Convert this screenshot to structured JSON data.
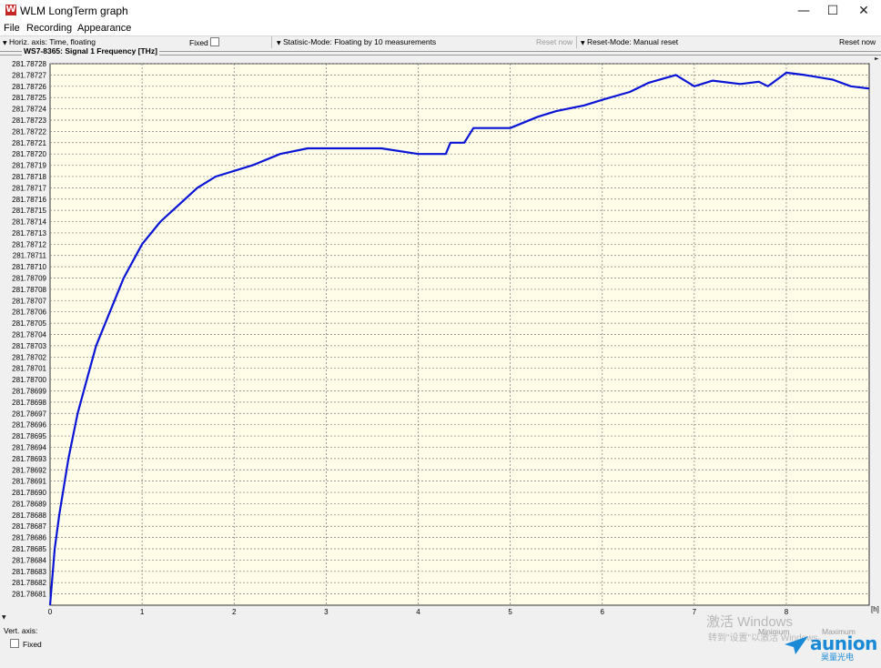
{
  "window": {
    "title": "WLM LongTerm graph",
    "icon": "wlm-app-icon",
    "min_glyph": "—",
    "max_glyph": "☐",
    "close_glyph": "✕"
  },
  "menu": [
    "File",
    "Recording",
    "Appearance"
  ],
  "toolbar": {
    "horiz_axis": "Horiz. axis: Time,  floating",
    "fixed_label": "Fixed",
    "statistic_mode": "Statisic-Mode: Floating by 10 measurements",
    "reset_now_disabled": "Reset now",
    "reset_mode": "Reset-Mode: Manual reset",
    "reset_now": "Reset now",
    "dropdown_glyph": "▼"
  },
  "signal": {
    "title": "WS7-8365: Signal 1  Frequency  [THz]"
  },
  "bottom": {
    "vert_axis": "Vert. axis:",
    "fixed_label": "Fixed",
    "minimum": "Minimum",
    "maximum": "Maximum",
    "watermark_line1": "激活 Windows",
    "watermark_line2": "转到\"设置\"以激活 Windows。",
    "brand_name": "aunion",
    "brand_sub": "昊量光电"
  },
  "colors": {
    "plot_bg": "#fffde8",
    "line": "#0a14d6",
    "grid": "#7a7a7a",
    "accent": "#c62828",
    "brand": "#1b8ad6"
  },
  "chart_data": {
    "type": "line",
    "ylabel": "Frequency [THz]",
    "xunit": "[h]",
    "xlim": [
      0,
      8.9
    ],
    "ylim": [
      281.7868,
      281.78728
    ],
    "x_ticks": [
      "0",
      "1",
      "2",
      "3",
      "4",
      "5",
      "6",
      "7",
      "8"
    ],
    "y_ticks": [
      "281.78728",
      "281.78727",
      "281.78726",
      "281.78725",
      "281.78724",
      "281.78723",
      "281.78722",
      "281.78721",
      "281.78720",
      "281.78719",
      "281.78718",
      "281.78717",
      "281.78716",
      "281.78715",
      "281.78714",
      "281.78713",
      "281.78712",
      "281.78711",
      "281.78710",
      "281.78709",
      "281.78708",
      "281.78707",
      "281.78706",
      "281.78705",
      "281.78704",
      "281.78703",
      "281.78702",
      "281.78701",
      "281.78700",
      "281.78699",
      "281.78698",
      "281.78697",
      "281.78696",
      "281.78695",
      "281.78694",
      "281.78693",
      "281.78692",
      "281.78691",
      "281.78690",
      "281.78689",
      "281.78688",
      "281.78687",
      "281.78686",
      "281.78685",
      "281.78684",
      "281.78683",
      "281.78682",
      "281.78681"
    ],
    "series": [
      {
        "x": [
          0,
          0.05,
          0.1,
          0.2,
          0.3,
          0.4,
          0.5,
          0.6,
          0.8,
          1.0,
          1.2,
          1.4,
          1.6,
          1.8,
          2.0,
          2.2,
          2.5,
          2.8,
          3.0,
          3.3,
          3.6,
          4.0,
          4.3,
          4.35,
          4.5,
          4.6,
          5.0,
          5.3,
          5.5,
          5.8,
          6.0,
          6.3,
          6.5,
          6.8,
          7.0,
          7.2,
          7.5,
          7.7,
          7.8,
          8.0,
          8.2,
          8.5,
          8.7,
          8.9
        ],
        "y": [
          281.7868,
          281.78685,
          281.78688,
          281.78693,
          281.78697,
          281.787,
          281.78703,
          281.78705,
          281.78709,
          281.78712,
          281.78714,
          281.787155,
          281.78717,
          281.78718,
          281.787185,
          281.78719,
          281.7872,
          281.787205,
          281.787205,
          281.787205,
          281.787205,
          281.7872,
          281.7872,
          281.78721,
          281.78721,
          281.787223,
          281.787223,
          281.787233,
          281.787238,
          281.787243,
          281.787248,
          281.787255,
          281.787263,
          281.78727,
          281.78726,
          281.787265,
          281.787262,
          281.787264,
          281.78726,
          281.787272,
          281.78727,
          281.787266,
          281.78726,
          281.787258
        ]
      }
    ]
  }
}
